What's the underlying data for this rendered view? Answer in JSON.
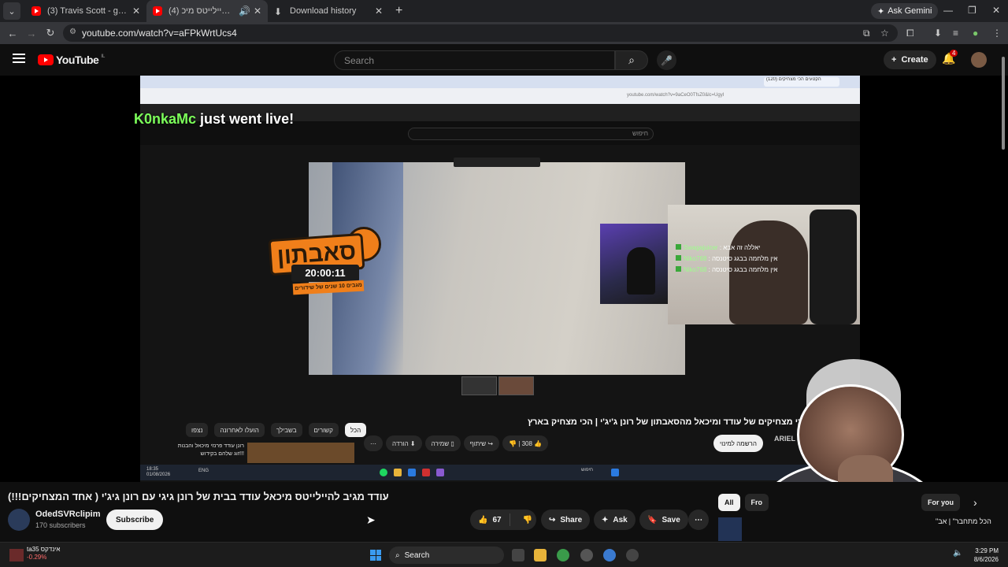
{
  "browser": {
    "tabs": [
      {
        "title": "(3) Travis Scott - goosebumps (",
        "active": false
      },
      {
        "title": "(4) עודד מגיב להיילייטס מיכ",
        "active": true
      },
      {
        "title": "Download history",
        "active": false
      }
    ],
    "ask_gemini": "Ask Gemini",
    "url": "youtube.com/watch?v=aFPkWrtUcs4"
  },
  "youtube": {
    "logo_text": "YouTube",
    "logo_country": "IL",
    "search_placeholder": "Search",
    "create_label": "Create",
    "notification_count": "4"
  },
  "player": {
    "live_user": "K0nkaMc",
    "live_text": "just went live!",
    "inner_url": "youtube.com/watch?v=9aCeO0TfsZ0&lc=UgyI",
    "inner_tab_title": "(120) הקטעים הכי מצחיקים",
    "inner_search": "חיפוש",
    "sabaton_title": "סאבתון",
    "sabaton_time": "20:00:11",
    "sabaton_sub": "מגבים 10 שנים של שידורים",
    "chat": [
      {
        "user": "Swagajuicer",
        "text": ": יאללה זה אבא"
      },
      {
        "user": "Niko768",
        "text": ": אין מלחמה בבגג סיטנסה"
      },
      {
        "user": "Niko768",
        "text": ": אין מלחמה בבגג סיטנסה"
      }
    ],
    "inner_title": "הכי מצחיקים של עודד ומיכאל מהסאבתון של רונן ג'יג'י | הכי מצחיק בארץ!",
    "inner_actions": {
      "likes": "308",
      "share": "שיתוף",
      "save": "שמירה",
      "download": "הורדה"
    },
    "inner_subscribe": "הרשמה למינוי",
    "inner_channel": "ARIEL",
    "inner_chips": [
      "הכל",
      "קשורים",
      "בשבילך",
      "הועלו לאחרונה",
      "נצפו"
    ],
    "inner_related_title": "רונן עודד פרנזי מיכאל והבנות זוג שלהם בקידוש!!!",
    "inner_clock": "18:35\n01/08/2026",
    "inner_lang": "ENG",
    "inner_taskbar_search": "חיפוש"
  },
  "video": {
    "title": "עודד מגיב להיילייטס מיכאל עודד בבית של רונן גיגי עם רונן גיג'י ( אחד המצחיקים!!!)",
    "channel": "OdedSVRclipim",
    "subscribers": "170 subscribers",
    "subscribe_label": "Subscribe",
    "likes": "67",
    "share_label": "Share",
    "ask_label": "Ask",
    "save_label": "Save"
  },
  "recommendations": {
    "chips": [
      "All",
      "Fro",
      "For you"
    ],
    "peek_title": "\"הכל מתחבר\" | אב"
  },
  "taskbar": {
    "weather_name": "ta35 אינדקס",
    "weather_change": "-0.29%",
    "search_label": "Search",
    "time": "3:29 PM",
    "date": "8/6/2026"
  },
  "colors": {
    "accent_red": "#ff0000",
    "live_green": "#7cff5a",
    "sabaton_orange": "#f07f1a"
  }
}
